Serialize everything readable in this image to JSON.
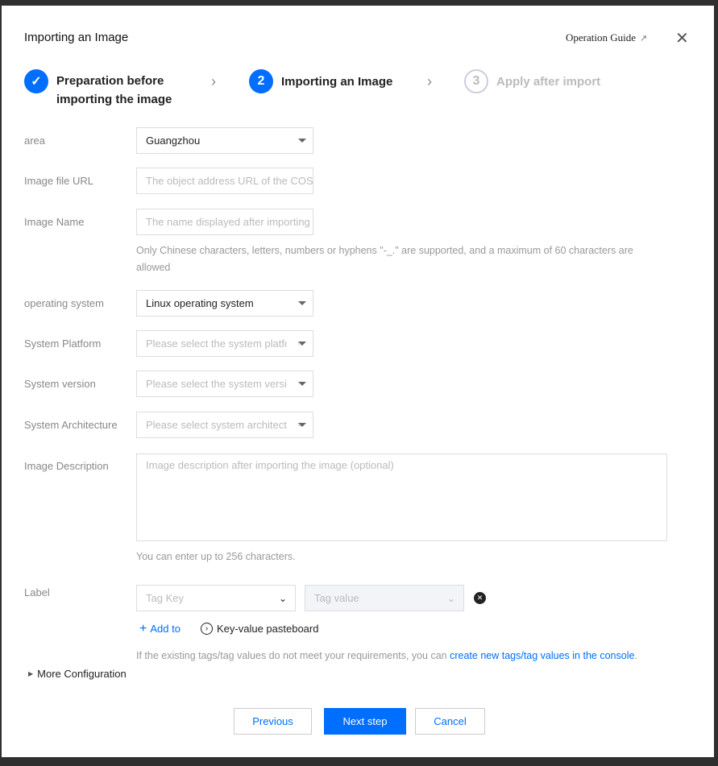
{
  "title": "Importing an Image",
  "operation_guide": "Operation Guide",
  "steps": [
    {
      "label_line1": "Preparation before",
      "label_line2": "importing the image",
      "state": "done"
    },
    {
      "number": "2",
      "label": "Importing an Image",
      "state": "active"
    },
    {
      "number": "3",
      "label": "Apply after import",
      "state": "pending"
    }
  ],
  "form": {
    "area": {
      "label": "area",
      "value": "Guangzhou"
    },
    "url": {
      "label": "Image file URL",
      "placeholder": "The object address URL of the COS"
    },
    "name": {
      "label": "Image Name",
      "placeholder": "The name displayed after importing",
      "hint": "Only Chinese characters, letters, numbers or hyphens \"-_.\" are supported, and a maximum of 60 characters are allowed"
    },
    "os": {
      "label": "operating system",
      "value": "Linux operating system"
    },
    "platform": {
      "label": "System Platform",
      "placeholder": "Please select the system platform"
    },
    "version": {
      "label": "System version",
      "placeholder": "Please select the system version"
    },
    "arch": {
      "label": "System Architecture",
      "placeholder": "Please select system architecture"
    },
    "desc": {
      "label": "Image Description",
      "placeholder": "Image description after importing the image (optional)",
      "hint": "You can enter up to 256 characters."
    },
    "tags": {
      "label": "Label",
      "key_placeholder": "Tag Key",
      "value_placeholder": "Tag value",
      "add": "Add to",
      "pasteboard": "Key-value pasteboard",
      "hint": "If the existing tags/tag values do not meet your requirements, you can ",
      "hint_link": "create new tags/tag values in the console",
      "hint_end": "."
    }
  },
  "more_config": "More Configuration",
  "buttons": {
    "previous": "Previous",
    "next": "Next step",
    "cancel": "Cancel"
  },
  "colors": {
    "primary": "#006eff"
  }
}
